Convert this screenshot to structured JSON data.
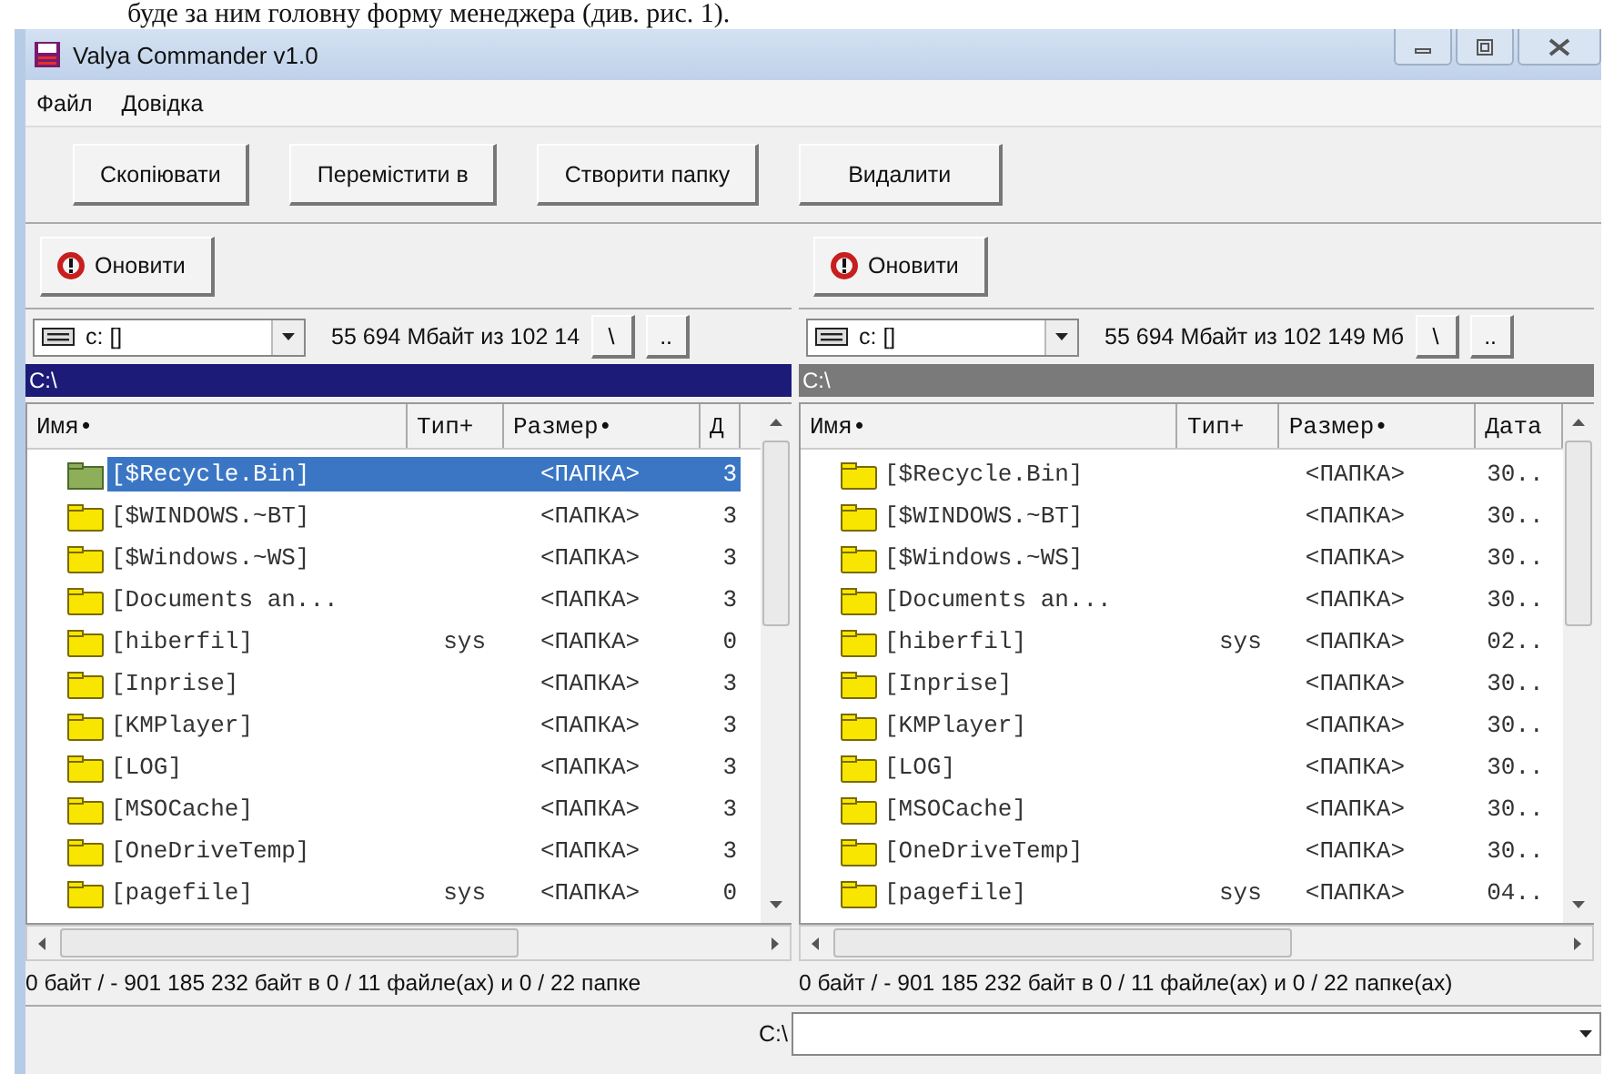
{
  "document_text": "буде за ним головну форму менеджера (див. рис. 1).",
  "window": {
    "title": "Valya Commander v1.0"
  },
  "menu": [
    "Файл",
    "Довідка"
  ],
  "toolbar": [
    "Скопіювати",
    "Перемістити в",
    "Створити папку",
    "Видалити"
  ],
  "panels": [
    {
      "active": true,
      "refresh_button": "Оновити",
      "drive": "c: []",
      "free_space": "55 694 Мбайт из 102 14",
      "root_button": "\\",
      "up_button": "..",
      "path": "C:\\",
      "columns": [
        "Имя•",
        "Тип+",
        "Размер•",
        "Д"
      ],
      "rows": [
        {
          "name": "[$Recycle.Bin]",
          "size": "<ПАПКА>",
          "date": "3",
          "selected": true
        },
        {
          "name": "[$WINDOWS.~BT]",
          "size": "<ПАПКА>",
          "date": "3",
          "selected": false
        },
        {
          "name": "[$Windows.~WS]",
          "size": "<ПАПКА>",
          "date": "3",
          "selected": false
        },
        {
          "name": "[Documents an...",
          "size": "<ПАПКА>",
          "date": "3",
          "selected": false
        },
        {
          "name": "[hiberfil]",
          "type": "sys",
          "size": "<ПАПКА>",
          "date": "0",
          "selected": false
        },
        {
          "name": "[Inprise]",
          "size": "<ПАПКА>",
          "date": "3",
          "selected": false
        },
        {
          "name": "[KMPlayer]",
          "size": "<ПАПКА>",
          "date": "3",
          "selected": false
        },
        {
          "name": "[LOG]",
          "size": "<ПАПКА>",
          "date": "3",
          "selected": false
        },
        {
          "name": "[MSOCache]",
          "size": "<ПАПКА>",
          "date": "3",
          "selected": false
        },
        {
          "name": "[OneDriveTemp]",
          "size": "<ПАПКА>",
          "date": "3",
          "selected": false
        },
        {
          "name": "[pagefile]",
          "type": "sys",
          "size": "<ПАПКА>",
          "date": "0",
          "selected": false
        }
      ],
      "status": "0 байт / - 901 185 232 байт в 0 / 11 файле(ах) и 0 / 22 папке"
    },
    {
      "active": false,
      "refresh_button": "Оновити",
      "drive": "c: []",
      "free_space": "55 694 Мбайт из 102 149 Мб",
      "root_button": "\\",
      "up_button": "..",
      "path": "C:\\",
      "columns": [
        "Имя•",
        "Тип+",
        "Размер•",
        "Дата"
      ],
      "rows": [
        {
          "name": "[$Recycle.Bin]",
          "size": "<ПАПКА>",
          "date": "30..",
          "selected": false
        },
        {
          "name": "[$WINDOWS.~BT]",
          "size": "<ПАПКА>",
          "date": "30..",
          "selected": false
        },
        {
          "name": "[$Windows.~WS]",
          "size": "<ПАПКА>",
          "date": "30..",
          "selected": false
        },
        {
          "name": "[Documents an...",
          "size": "<ПАПКА>",
          "date": "30..",
          "selected": false
        },
        {
          "name": "[hiberfil]",
          "type": "sys",
          "size": "<ПАПКА>",
          "date": "02..",
          "selected": false
        },
        {
          "name": "[Inprise]",
          "size": "<ПАПКА>",
          "date": "30..",
          "selected": false
        },
        {
          "name": "[KMPlayer]",
          "size": "<ПАПКА>",
          "date": "30..",
          "selected": false
        },
        {
          "name": "[LOG]",
          "size": "<ПАПКА>",
          "date": "30..",
          "selected": false
        },
        {
          "name": "[MSOCache]",
          "size": "<ПАПКА>",
          "date": "30..",
          "selected": false
        },
        {
          "name": "[OneDriveTemp]",
          "size": "<ПАПКА>",
          "date": "30..",
          "selected": false
        },
        {
          "name": "[pagefile]",
          "type": "sys",
          "size": "<ПАПКА>",
          "date": "04..",
          "selected": false
        }
      ],
      "status": "0 байт / - 901 185 232 байт в 0 / 11 файле(ах) и 0 / 22 папке(ах)"
    }
  ],
  "command": {
    "label": "C:\\"
  }
}
